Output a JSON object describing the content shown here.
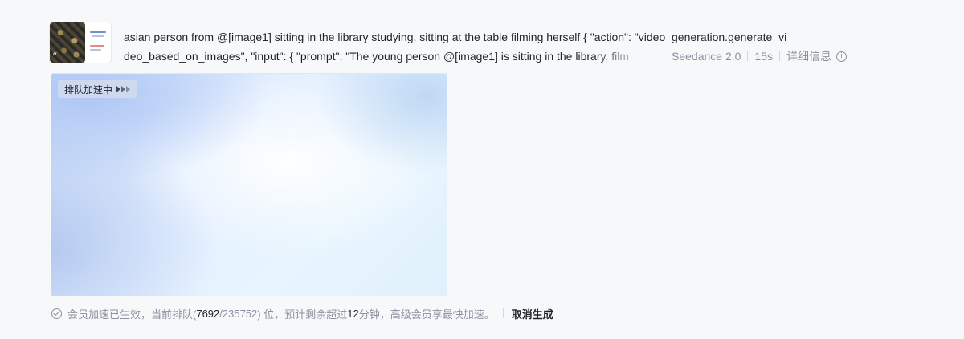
{
  "task": {
    "prompt_line_1": "asian person from @[image1] sitting in the library studying, sitting at the table filming herself { \"action\": \"video_generation.generate_vi",
    "prompt_line_2": "deo_based_on_images\", \"input\": { \"prompt\": \"The young person @[image1] is sitting in the library, film",
    "model": "Seedance 2.0",
    "duration": "15s",
    "detail_label": "详细信息",
    "info_glyph": "i",
    "thumbnail_quote": "“"
  },
  "video": {
    "queue_badge": "排队加速中"
  },
  "status": {
    "prefix": "会员加速已生效，当前排队(",
    "position": "7692",
    "slash": "/",
    "total": "235752",
    "suffix_before_minutes": ") 位，预计剩余超过 ",
    "minutes": "12",
    "suffix_after_minutes": " 分钟，高级会员享最快加速。",
    "cancel_label": "取消生成"
  }
}
